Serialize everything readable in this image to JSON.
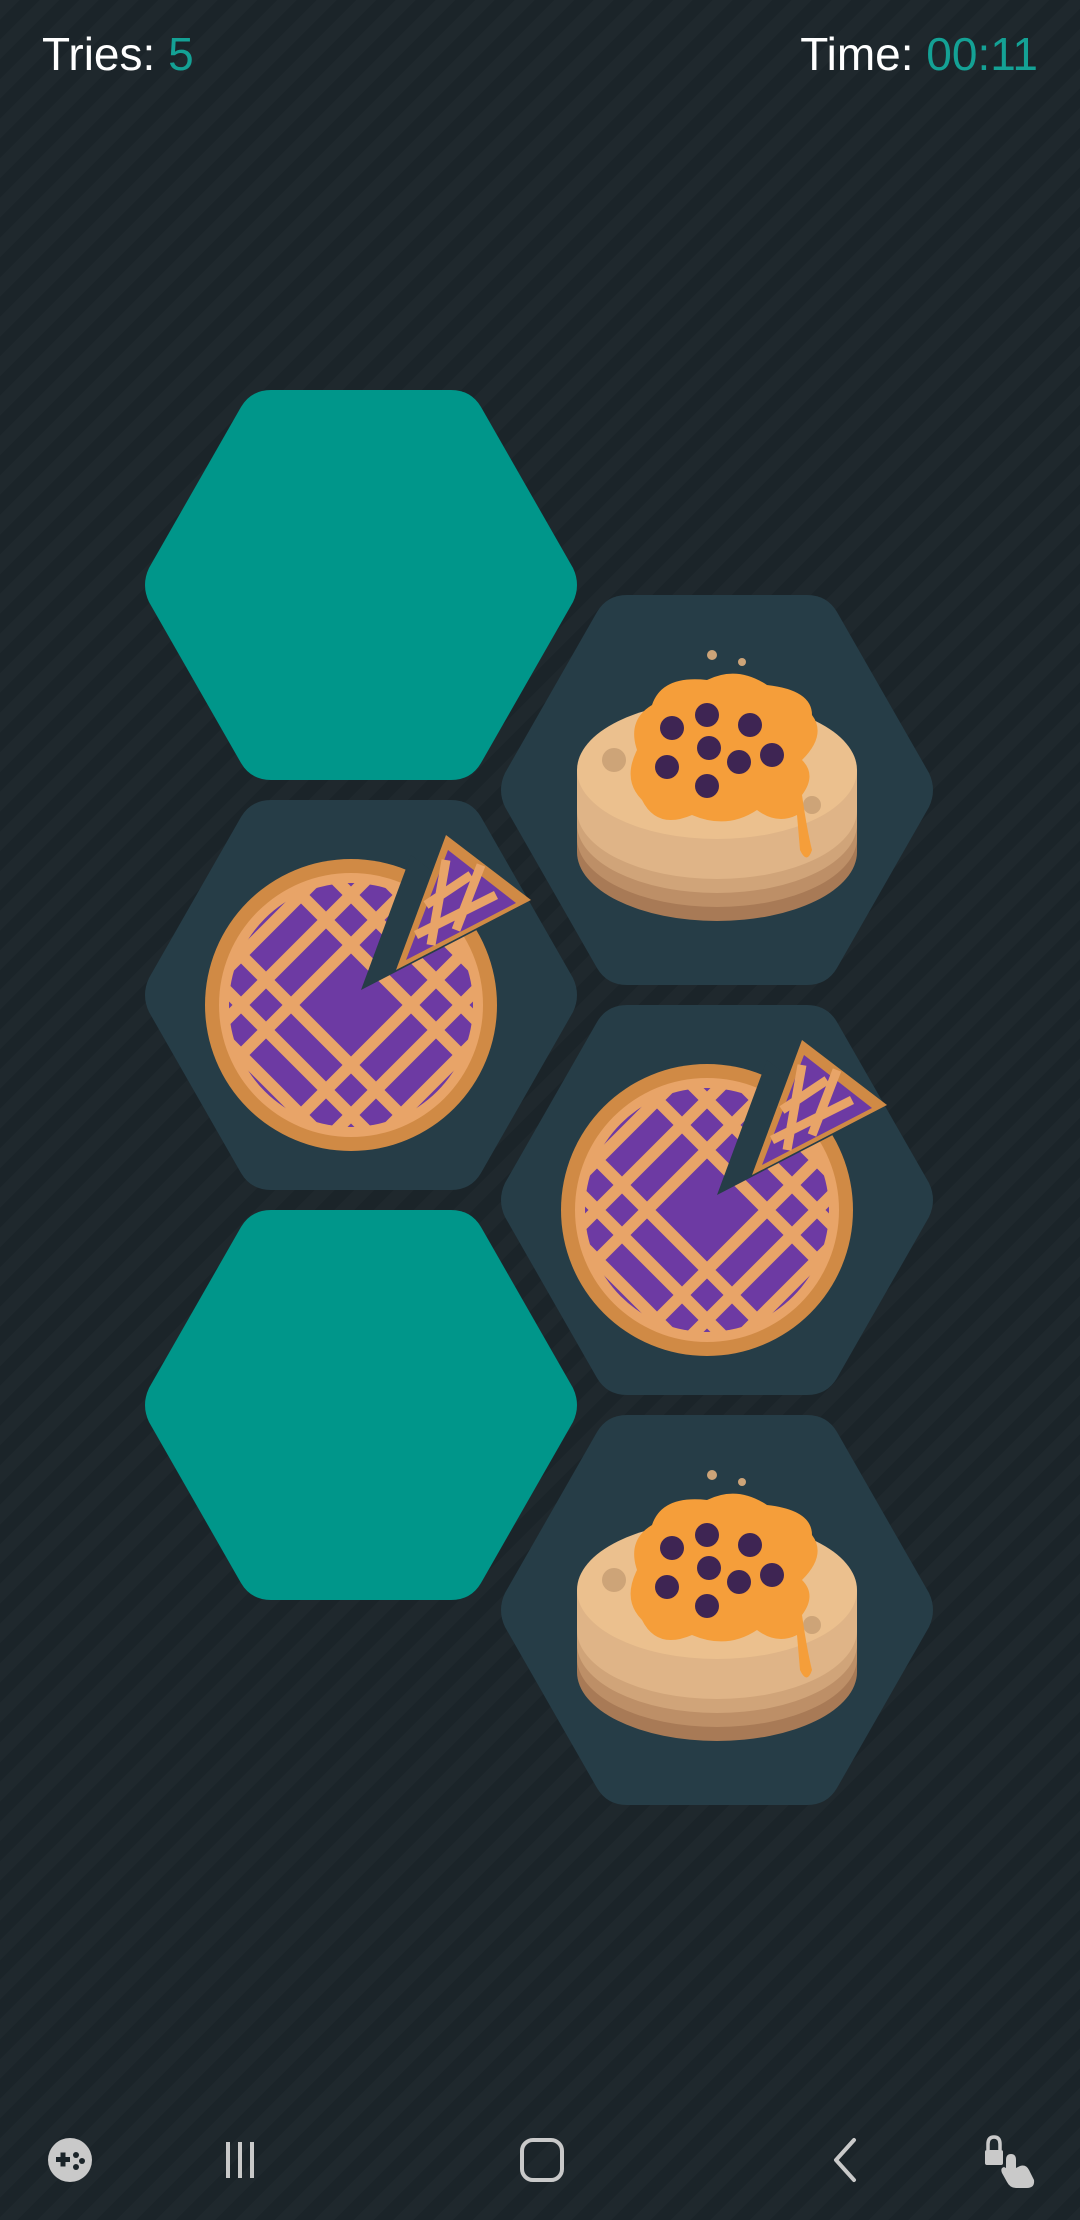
{
  "hud": {
    "tries_label": "Tries:",
    "tries_value": "5",
    "time_label": "Time:",
    "time_value": "00:11"
  },
  "colors": {
    "background": "#1b2429",
    "accent": "#14a195",
    "tile_hidden": "#00968a",
    "tile_revealed": "#263d47"
  },
  "board": {
    "tiles": [
      {
        "state": "hidden",
        "icon": null
      },
      {
        "state": "revealed",
        "icon": "cheesecake-icon"
      },
      {
        "state": "revealed",
        "icon": "blueberry-pie-icon"
      },
      {
        "state": "revealed",
        "icon": "blueberry-pie-icon"
      },
      {
        "state": "hidden",
        "icon": null
      },
      {
        "state": "revealed",
        "icon": "cheesecake-icon"
      }
    ]
  },
  "navbar": {
    "buttons": [
      "game-launcher-icon",
      "recent-apps-icon",
      "home-icon",
      "back-icon",
      "touch-lock-icon"
    ]
  }
}
